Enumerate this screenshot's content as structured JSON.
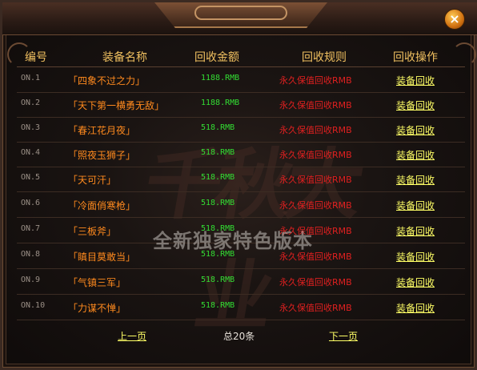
{
  "window": {
    "close_label": "×"
  },
  "watermark": {
    "big_text": "千秋大业",
    "subtitle": "全新独家特色版本"
  },
  "table": {
    "headers": [
      "编号",
      "装备名称",
      "回收金额",
      "回收规则",
      "回收操作"
    ],
    "rows": [
      {
        "no": "ON.1",
        "name": "「四象不过之力」",
        "price": "1188.RMB",
        "rule": "永久保值回收RMB",
        "action": "装备回收"
      },
      {
        "no": "ON.2",
        "name": "「天下第一横勇无敌」",
        "price": "1188.RMB",
        "rule": "永久保值回收RMB",
        "action": "装备回收"
      },
      {
        "no": "ON.3",
        "name": "「春江花月夜」",
        "price": "518.RMB",
        "rule": "永久保值回收RMB",
        "action": "装备回收"
      },
      {
        "no": "ON.4",
        "name": "「照夜玉狮子」",
        "price": "518.RMB",
        "rule": "永久保值回收RMB",
        "action": "装备回收"
      },
      {
        "no": "ON.5",
        "name": "「天可汗」",
        "price": "518.RMB",
        "rule": "永久保值回收RMB",
        "action": "装备回收"
      },
      {
        "no": "ON.6",
        "name": "「冷面俏寒枪」",
        "price": "518.RMB",
        "rule": "永久保值回收RMB",
        "action": "装备回收"
      },
      {
        "no": "ON.7",
        "name": "「三板斧」",
        "price": "518.RMB",
        "rule": "永久保值回收RMB",
        "action": "装备回收"
      },
      {
        "no": "ON.8",
        "name": "「瞋目莫敢当」",
        "price": "518.RMB",
        "rule": "永久保值回收RMB",
        "action": "装备回收"
      },
      {
        "no": "ON.9",
        "name": "「气镇三军」",
        "price": "518.RMB",
        "rule": "永久保值回收RMB",
        "action": "装备回收"
      },
      {
        "no": "ON.10",
        "name": "「力谋不惮」",
        "price": "518.RMB",
        "rule": "永久保值回收RMB",
        "action": "装备回收"
      }
    ]
  },
  "pager": {
    "prev": "上一页",
    "total": "总20条",
    "next": "下一页"
  },
  "colors": {
    "header_text": "#f0c060",
    "name_text": "#ff8a1e",
    "price_text": "#33dd33",
    "rule_text": "#e02020",
    "link_text": "#ffff66"
  }
}
